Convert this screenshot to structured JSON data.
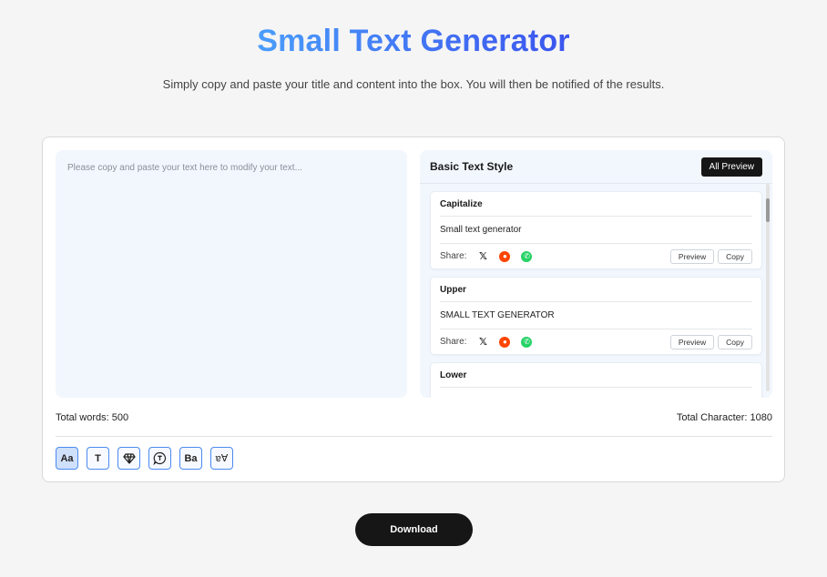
{
  "header": {
    "title": "Small Text Generator",
    "subtitle": "Simply copy and paste your title and content into the box. You will then be notified of the results."
  },
  "editor": {
    "placeholder": "Please copy and paste your text here to modify your text...",
    "value": ""
  },
  "styles_panel": {
    "title": "Basic Text Style",
    "all_preview_label": "All Preview",
    "share_label": "Share:",
    "preview_label": "Preview",
    "copy_label": "Copy",
    "items": [
      {
        "name": "Capitalize",
        "text": "Small text generator"
      },
      {
        "name": "Upper",
        "text": "SMALL TEXT GENERATOR"
      },
      {
        "name": "Lower",
        "text": ""
      }
    ],
    "share_icons": [
      "x-icon",
      "reddit-icon",
      "whatsapp-icon"
    ],
    "scroll_position": 0.05
  },
  "stats": {
    "words_label": "Total words: 500",
    "chars_label": "Total Character: 1080"
  },
  "tools": [
    {
      "icon": "font-style-icon",
      "glyph": "Aa",
      "active": true
    },
    {
      "icon": "text-icon",
      "glyph": "T",
      "active": false
    },
    {
      "icon": "diamond-icon",
      "glyph": "💎",
      "active": false
    },
    {
      "icon": "speech-bubble-text-icon",
      "glyph": "T",
      "active": false
    },
    {
      "icon": "bold-icon",
      "glyph": "Ba",
      "active": false
    },
    {
      "icon": "flip-text-icon",
      "glyph": "ɐ∀",
      "active": false
    }
  ],
  "footer": {
    "download_label": "Download"
  },
  "colors": {
    "title_gradient_start": "#4a9dfb",
    "title_gradient_end": "#3b55ee",
    "panel_bg": "#f2f7fe",
    "button_dark": "#161616",
    "reddit": "#ff4500",
    "whatsapp": "#25d366",
    "tool_border": "#4a8af0"
  }
}
